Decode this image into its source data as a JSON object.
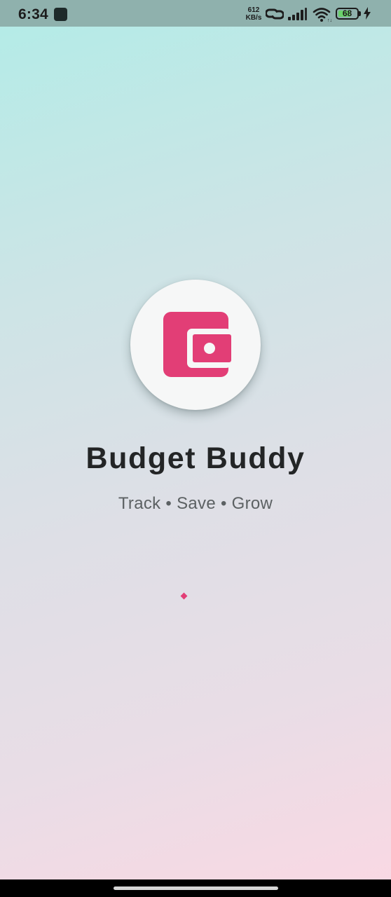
{
  "status_bar": {
    "time": "6:34",
    "net_speed_value": "612",
    "net_speed_unit": "KB/s",
    "battery_level": "68",
    "battery_percent": 68,
    "icons": [
      "app-notification-icon",
      "link-icon",
      "signal-icon",
      "wifi-icon",
      "battery-icon",
      "charging-icon"
    ]
  },
  "splash": {
    "logo_icon": "wallet-icon",
    "title": "Budget Buddy",
    "tagline": "Track • Save • Grow",
    "loading_indicator": "loading-indicator"
  },
  "colors": {
    "accent": "#e23e76",
    "logo_background": "#f6f7f7",
    "gradient_top": "#b2ece7",
    "gradient_bottom": "#fad8e3",
    "title_text": "#232526",
    "tagline_text": "#5c6163"
  }
}
